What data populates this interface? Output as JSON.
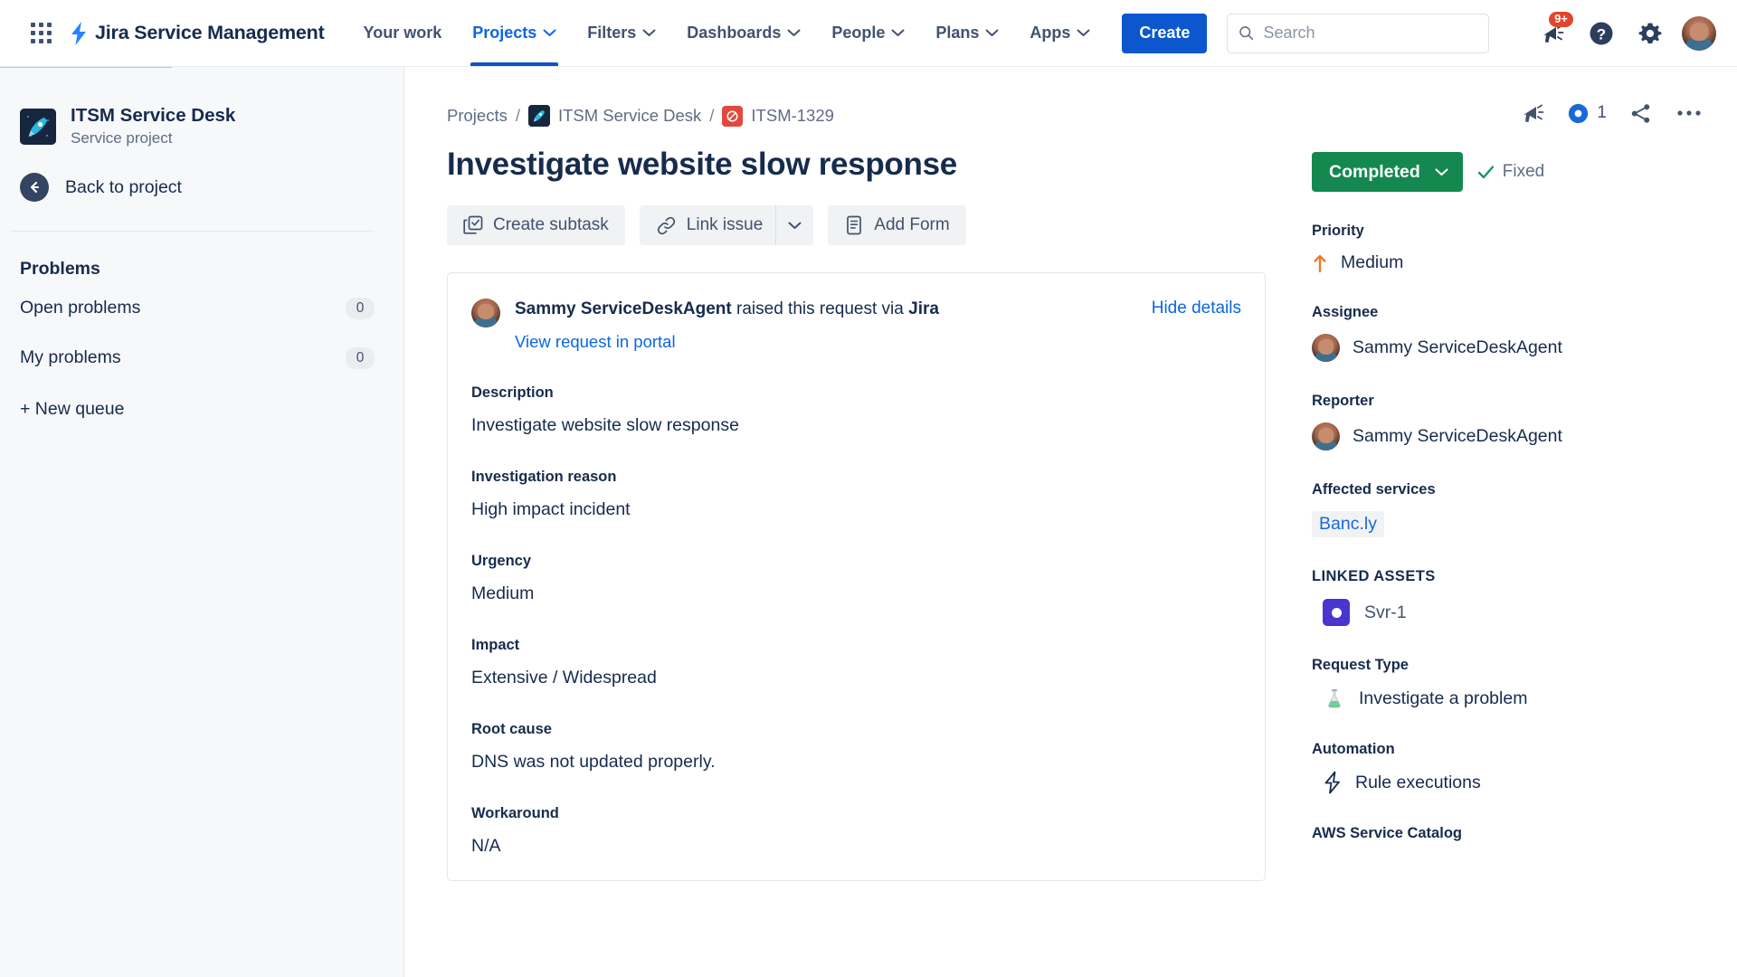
{
  "topnav": {
    "app_switcher_icon": "grid-apps-icon",
    "brand": "Jira Service Management",
    "brand_icon": "jira-service-management-bolt-icon",
    "items": [
      {
        "label": "Your work",
        "has_caret": false,
        "active": false
      },
      {
        "label": "Projects",
        "has_caret": true,
        "active": true
      },
      {
        "label": "Filters",
        "has_caret": true,
        "active": false
      },
      {
        "label": "Dashboards",
        "has_caret": true,
        "active": false
      },
      {
        "label": "People",
        "has_caret": true,
        "active": false
      },
      {
        "label": "Plans",
        "has_caret": true,
        "active": false
      },
      {
        "label": "Apps",
        "has_caret": true,
        "active": false
      }
    ],
    "create_label": "Create",
    "search": {
      "placeholder": "Search",
      "value": "",
      "icon": "search-icon"
    },
    "notifications": {
      "icon": "megaphone-icon",
      "badge": "9+"
    },
    "help_icon": "help-circle-icon",
    "settings_icon": "gear-icon",
    "profile_icon": "user-avatar"
  },
  "sidebar": {
    "project": {
      "name": "ITSM Service Desk",
      "type": "Service project",
      "icon": "rocket-project-icon"
    },
    "back": {
      "label": "Back to project",
      "icon": "arrow-left-icon"
    },
    "section_title": "Problems",
    "items": [
      {
        "label": "Open problems",
        "count": "0"
      },
      {
        "label": "My problems",
        "count": "0"
      }
    ],
    "new_queue": "+ New queue"
  },
  "content": {
    "breadcrumb": [
      {
        "label": "Projects",
        "icon": null
      },
      {
        "label": "ITSM Service Desk",
        "icon": "rocket-project-icon"
      },
      {
        "label": "ITSM-1329",
        "icon": "problem-issue-icon"
      }
    ],
    "breadcrumb_separator": "/",
    "title": "Investigate website slow response",
    "actions": [
      {
        "label": "Create subtask",
        "icon": "subtask-icon",
        "split": false
      },
      {
        "label": "Link issue",
        "icon": "link-icon",
        "split": true,
        "caret_icon": "chevron-down-icon"
      },
      {
        "label": "Add Form",
        "icon": "form-icon",
        "split": false
      }
    ],
    "request_card": {
      "raiser_name": "Sammy ServiceDeskAgent",
      "raiser_middle": " raised this request via ",
      "raiser_channel": "Jira",
      "portal_link": "View request in portal",
      "hide_details": "Hide details",
      "avatar_icon": "user-avatar",
      "fields": [
        {
          "label": "Description",
          "value": "Investigate website slow response"
        },
        {
          "label": "Investigation reason",
          "value": "High impact incident"
        },
        {
          "label": "Urgency",
          "value": "Medium"
        },
        {
          "label": "Impact",
          "value": "Extensive / Widespread"
        },
        {
          "label": "Root cause",
          "value": "DNS was not updated properly."
        },
        {
          "label": "Workaround",
          "value": "N/A"
        }
      ]
    }
  },
  "rightpanel": {
    "toolbar": {
      "feedback_icon": "megaphone-icon",
      "watch_icon": "eye-icon",
      "watch_count": "1",
      "share_icon": "share-icon",
      "more_icon": "more-ellipsis-icon"
    },
    "status": {
      "label": "Completed",
      "caret_icon": "chevron-down-icon",
      "color": "#14884F"
    },
    "resolution": {
      "label": "Fixed",
      "icon": "check-icon"
    },
    "priority": {
      "label": "Priority",
      "value": "Medium",
      "icon": "priority-medium-arrow-icon",
      "color": "#F1751F"
    },
    "assignee": {
      "label": "Assignee",
      "value": "Sammy ServiceDeskAgent",
      "icon": "user-avatar"
    },
    "reporter": {
      "label": "Reporter",
      "value": "Sammy ServiceDeskAgent",
      "icon": "user-avatar"
    },
    "affected_services": {
      "label": "Affected services",
      "value": "Banc.ly"
    },
    "linked_assets": {
      "label": "LINKED ASSETS",
      "value": "Svr-1",
      "icon": "asset-server-icon"
    },
    "request_type": {
      "label": "Request Type",
      "value": "Investigate a problem",
      "icon": "investigate-problem-icon"
    },
    "automation": {
      "label": "Automation",
      "value": "Rule executions",
      "icon": "lightning-bolt-icon"
    },
    "aws_service_catalog": {
      "label": "AWS Service Catalog"
    }
  }
}
